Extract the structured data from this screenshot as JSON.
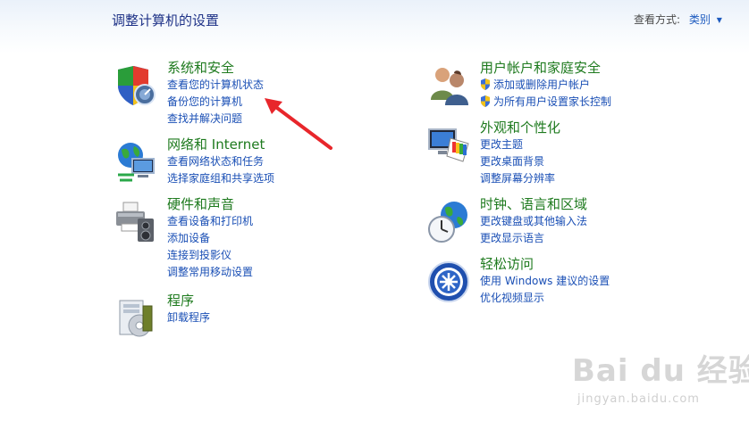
{
  "page": {
    "title": "调整计算机的设置",
    "view_by_label": "查看方式:",
    "view_by_value": "类别"
  },
  "left_column": [
    {
      "title": "系统和安全",
      "icon": "shield-computer-icon",
      "tasks": [
        {
          "label": "查看您的计算机状态"
        },
        {
          "label": "备份您的计算机"
        },
        {
          "label": "查找并解决问题"
        }
      ]
    },
    {
      "title": "网络和 Internet",
      "icon": "network-globe-icon",
      "tasks": [
        {
          "label": "查看网络状态和任务"
        },
        {
          "label": "选择家庭组和共享选项"
        }
      ]
    },
    {
      "title": "硬件和声音",
      "icon": "printer-speaker-icon",
      "tasks": [
        {
          "label": "查看设备和打印机"
        },
        {
          "label": "添加设备"
        },
        {
          "label": "连接到投影仪"
        },
        {
          "label": "调整常用移动设置"
        }
      ]
    },
    {
      "title": "程序",
      "icon": "programs-icon",
      "tasks": [
        {
          "label": "卸载程序"
        }
      ]
    }
  ],
  "right_column": [
    {
      "title": "用户帐户和家庭安全",
      "icon": "users-icon",
      "tasks": [
        {
          "label": "添加或删除用户帐户",
          "shield": true
        },
        {
          "label": "为所有用户设置家长控制",
          "shield": true
        }
      ]
    },
    {
      "title": "外观和个性化",
      "icon": "monitor-palette-icon",
      "tasks": [
        {
          "label": "更改主题"
        },
        {
          "label": "更改桌面背景"
        },
        {
          "label": "调整屏幕分辨率"
        }
      ]
    },
    {
      "title": "时钟、语言和区域",
      "icon": "clock-globe-icon",
      "tasks": [
        {
          "label": "更改键盘或其他输入法"
        },
        {
          "label": "更改显示语言"
        }
      ]
    },
    {
      "title": "轻松访问",
      "icon": "ease-of-access-icon",
      "tasks": [
        {
          "label": "使用 Windows 建议的设置"
        },
        {
          "label": "优化视频显示"
        }
      ]
    }
  ],
  "annotation": {
    "color": "#e8262b"
  },
  "watermark": {
    "logo": "Bai du 经验",
    "sub": "jingyan.baidu.com"
  }
}
